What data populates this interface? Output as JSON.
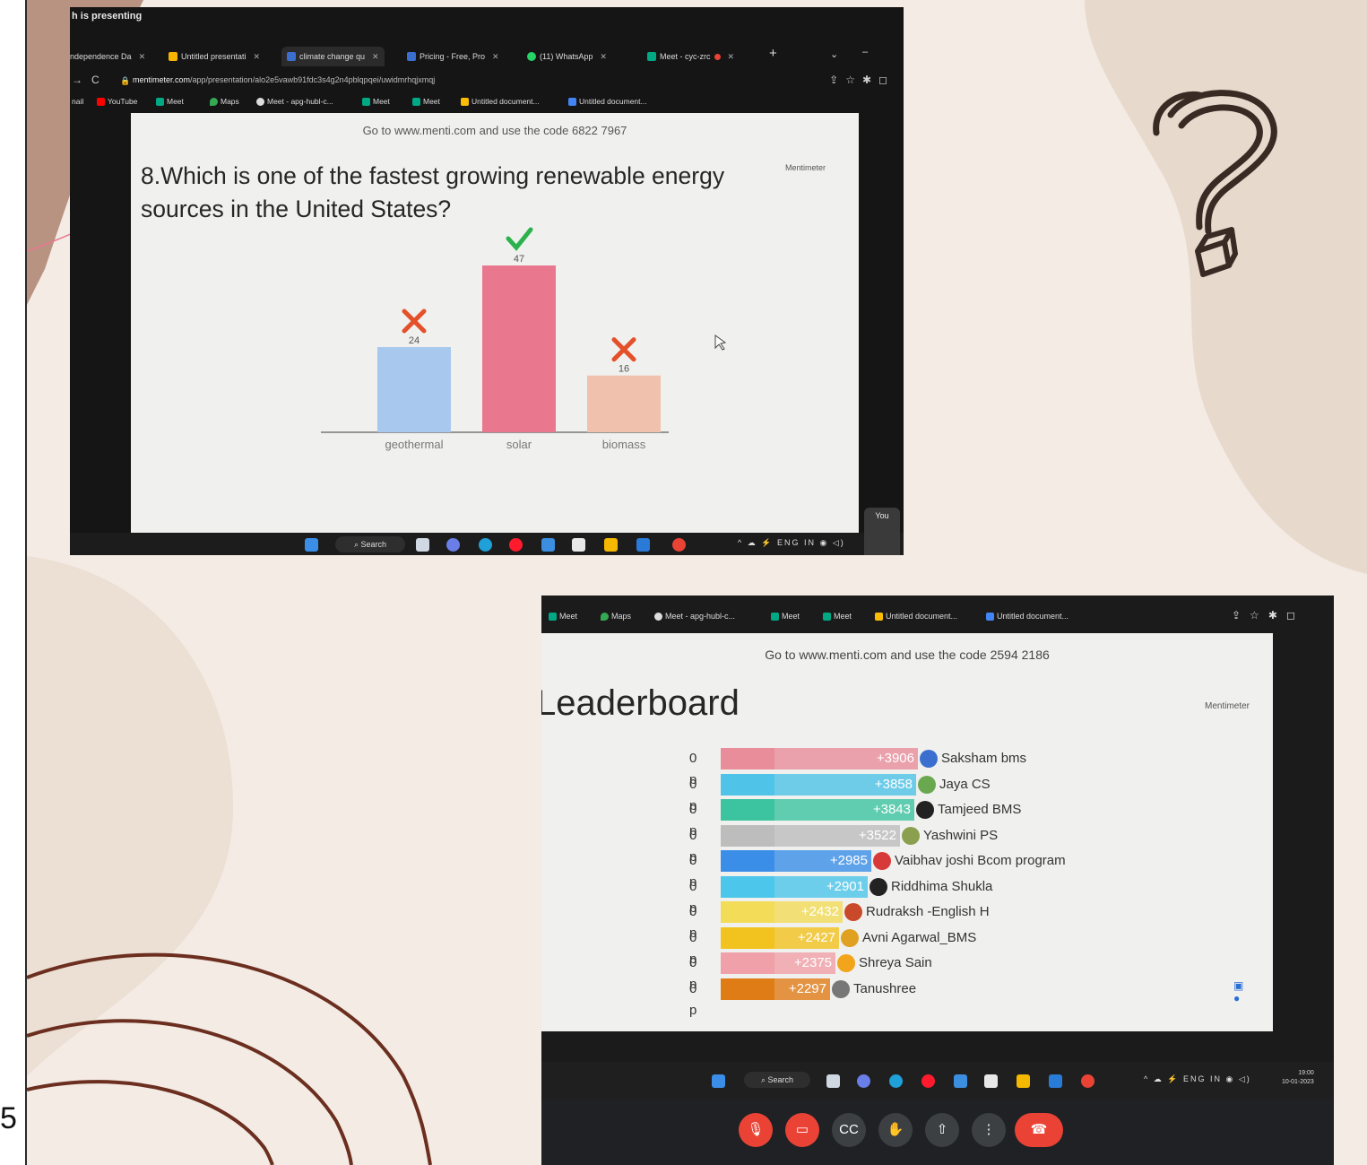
{
  "left_edge_text": "5",
  "colors": {
    "slide_bg": "#f3ebe4",
    "blob": "#e8d9cd",
    "line": "#6b2e1f",
    "accent_pink": "#e9788f"
  },
  "shot1": {
    "banner": "h is presenting",
    "tabs": [
      {
        "label": "ndependence Da",
        "icon": "page-icon"
      },
      {
        "label": "Untitled presentati",
        "icon": "slides-icon"
      },
      {
        "label": "climate change qu",
        "icon": "mentimeter-icon"
      },
      {
        "label": "Pricing - Free, Pro",
        "icon": "mentimeter-icon"
      },
      {
        "label": "(11) WhatsApp",
        "icon": "whatsapp-icon"
      },
      {
        "label": "Meet - cyc-zrc",
        "icon": "meet-icon"
      }
    ],
    "url_host": "mentimeter.com",
    "url_path": "/app/presentation/alo2e5vawb91fdc3s4g2n4pblqpqei/uwidmrhqjxmqj",
    "bookmarks": [
      "nail",
      "YouTube",
      "Meet",
      "Maps",
      "Meet - apg-hubl-c...",
      "Meet",
      "Meet",
      "Untitled document...",
      "Untitled document..."
    ],
    "join_text": "Go to www.menti.com and use the code 6822 7967",
    "brand": "Mentimeter",
    "question": "8.Which is one of the fastest growing renewable energy sources in the United States?",
    "taskbar": {
      "search": "Search",
      "lang": "ENG",
      "region": "IN",
      "you": "You"
    }
  },
  "chart_data": {
    "type": "bar",
    "categories": [
      "geothermal",
      "solar",
      "biomass"
    ],
    "values": [
      24,
      47,
      16
    ],
    "correct": [
      false,
      true,
      false
    ],
    "colors": [
      "#a8c8ee",
      "#e9788f",
      "#f0c2ae"
    ],
    "ylim": [
      0,
      47
    ]
  },
  "shot2": {
    "bookmarks": [
      "Meet",
      "Maps",
      "Meet - apg-hubl-c...",
      "Meet",
      "Meet",
      "Untitled document...",
      "Untitled document..."
    ],
    "join_text": "Go to www.menti.com and use the code 2594 2186",
    "title": "Leaderboard",
    "brand": "Mentimeter",
    "leaderboard": [
      {
        "pts": "0 p",
        "score": "+3906",
        "name": "Saksham bms",
        "color": "#e98d9b",
        "avatar": "#3b6fcf"
      },
      {
        "pts": "0 p",
        "score": "+3858",
        "name": "Jaya CS",
        "color": "#4fc3e8",
        "avatar": "#6aa84f"
      },
      {
        "pts": "0 p",
        "score": "+3843",
        "name": "Tamjeed BMS",
        "color": "#3cc4a0",
        "avatar": "#222222"
      },
      {
        "pts": "0 p",
        "score": "+3522",
        "name": "Yashwini PS",
        "color": "#bdbdbd",
        "avatar": "#8aa04f"
      },
      {
        "pts": "0 p",
        "score": "+2985",
        "name": "Vaibhav joshi Bcom program",
        "color": "#3a8ee8",
        "avatar": "#d83a3a"
      },
      {
        "pts": "0 p",
        "score": "+2901",
        "name": "Riddhima Shukla",
        "color": "#4cc6ea",
        "avatar": "#222222"
      },
      {
        "pts": "0 p",
        "score": "+2432",
        "name": "Rudraksh -English H",
        "color": "#f2dc58",
        "avatar": "#c94a2a"
      },
      {
        "pts": "0 p",
        "score": "+2427",
        "name": "Avni Agarwal_BMS",
        "color": "#f2c21e",
        "avatar": "#e0a020"
      },
      {
        "pts": "0 p",
        "score": "+2375",
        "name": "Shreya Sain",
        "color": "#f0a0a8",
        "avatar": "#f2a51a"
      },
      {
        "pts": "0 p",
        "score": "+2297",
        "name": "Tanushree",
        "color": "#e07c16",
        "avatar": "#777777"
      }
    ],
    "taskbar": {
      "search": "Search",
      "lang": "ENG",
      "region": "IN",
      "time": "19:00",
      "date": "10-01-2023"
    }
  }
}
